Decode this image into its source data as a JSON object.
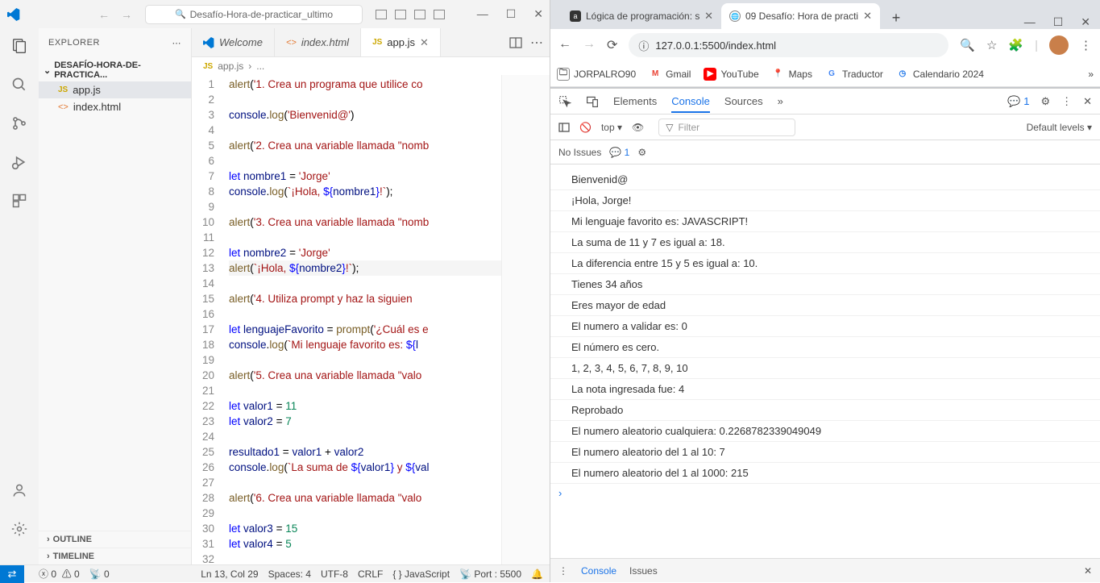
{
  "vscode": {
    "search_placeholder": "Desafío-Hora-de-practicar_ultimo",
    "explorer": {
      "title": "EXPLORER",
      "root": "DESAFÍO-HORA-DE-PRACTICA...",
      "files": [
        {
          "name": "app.js",
          "icon": "JS",
          "icon_color": "#cca700"
        },
        {
          "name": "index.html",
          "icon": "<>",
          "icon_color": "#e37933"
        }
      ],
      "outline": "OUTLINE",
      "timeline": "TIMELINE"
    },
    "tabs": {
      "welcome": "Welcome",
      "index": "index.html",
      "appjs": "app.js"
    },
    "breadcrumb": {
      "file": "app.js",
      "sep": "›",
      "rest": "..."
    },
    "code_lines": [
      {
        "n": 1,
        "html": "<span class='tok-fn'>alert</span>(<span class='tok-str'>'1. Crea un programa que utilice co</span>"
      },
      {
        "n": 2,
        "html": ""
      },
      {
        "n": 3,
        "html": "<span class='tok-id'>console</span>.<span class='tok-fn'>log</span>(<span class='tok-str'>'Bienvenid@'</span>)"
      },
      {
        "n": 4,
        "html": ""
      },
      {
        "n": 5,
        "html": "<span class='tok-fn'>alert</span>(<span class='tok-str'>'2. Crea una variable llamada \"nomb</span>"
      },
      {
        "n": 6,
        "html": ""
      },
      {
        "n": 7,
        "html": "<span class='tok-kw'>let</span> <span class='tok-id'>nombre1</span> = <span class='tok-str'>'Jorge'</span>"
      },
      {
        "n": 8,
        "html": "<span class='tok-id'>console</span>.<span class='tok-fn'>log</span>(<span class='tok-str'>`¡Hola, </span><span class='tok-kw'>${</span><span class='tok-id'>nombre1</span><span class='tok-kw'>}</span><span class='tok-str'>!`</span>);"
      },
      {
        "n": 9,
        "html": ""
      },
      {
        "n": 10,
        "html": "<span class='tok-fn'>alert</span>(<span class='tok-str'>'3. Crea una variable llamada \"nomb</span>"
      },
      {
        "n": 11,
        "html": ""
      },
      {
        "n": 12,
        "html": "<span class='tok-kw'>let</span> <span class='tok-id'>nombre2</span> = <span class='tok-str'>'Jorge'</span>"
      },
      {
        "n": 13,
        "html": "<span class='tok-fn'>alert</span>(<span class='tok-str'>`¡Hola, </span><span class='tok-kw'>${</span><span class='tok-id'>nombre2</span><span class='tok-kw'>}</span><span class='tok-str'>!`</span>);",
        "hl": true
      },
      {
        "n": 14,
        "html": ""
      },
      {
        "n": 15,
        "html": "<span class='tok-fn'>alert</span>(<span class='tok-str'>'4. Utiliza prompt y haz la siguien</span>"
      },
      {
        "n": 16,
        "html": ""
      },
      {
        "n": 17,
        "html": "<span class='tok-kw'>let</span> <span class='tok-id'>lenguajeFavorito</span> = <span class='tok-fn'>prompt</span>(<span class='tok-str'>'¿Cuál es e</span>"
      },
      {
        "n": 18,
        "html": "<span class='tok-id'>console</span>.<span class='tok-fn'>log</span>(<span class='tok-str'>`Mi lenguaje favorito es: </span><span class='tok-kw'>${</span><span class='tok-id'>l</span>"
      },
      {
        "n": 19,
        "html": ""
      },
      {
        "n": 20,
        "html": "<span class='tok-fn'>alert</span>(<span class='tok-str'>'5. Crea una variable llamada \"valo</span>"
      },
      {
        "n": 21,
        "html": ""
      },
      {
        "n": 22,
        "html": "<span class='tok-kw'>let</span> <span class='tok-id'>valor1</span> = <span class='tok-num'>11</span>"
      },
      {
        "n": 23,
        "html": "<span class='tok-kw'>let</span> <span class='tok-id'>valor2</span> = <span class='tok-num'>7</span>"
      },
      {
        "n": 24,
        "html": ""
      },
      {
        "n": 25,
        "html": "<span class='tok-id'>resultado1</span> = <span class='tok-id'>valor1</span> + <span class='tok-id'>valor2</span>"
      },
      {
        "n": 26,
        "html": "<span class='tok-id'>console</span>.<span class='tok-fn'>log</span>(<span class='tok-str'>`La suma de </span><span class='tok-kw'>${</span><span class='tok-id'>valor1</span><span class='tok-kw'>}</span><span class='tok-str'> y </span><span class='tok-kw'>${</span><span class='tok-id'>val</span>"
      },
      {
        "n": 27,
        "html": ""
      },
      {
        "n": 28,
        "html": "<span class='tok-fn'>alert</span>(<span class='tok-str'>'6. Crea una variable llamada \"valo</span>"
      },
      {
        "n": 29,
        "html": ""
      },
      {
        "n": 30,
        "html": "<span class='tok-kw'>let</span> <span class='tok-id'>valor3</span> = <span class='tok-num'>15</span>"
      },
      {
        "n": 31,
        "html": "<span class='tok-kw'>let</span> <span class='tok-id'>valor4</span> = <span class='tok-num'>5</span>"
      },
      {
        "n": 32,
        "html": ""
      }
    ],
    "status": {
      "errors": "0",
      "warnings": "0",
      "radio": "0",
      "cursor": "Ln 13, Col 29",
      "spaces": "Spaces: 4",
      "encoding": "UTF-8",
      "eol": "CRLF",
      "lang": "{ } JavaScript",
      "port": "Port : 5500"
    }
  },
  "browser": {
    "tabs": [
      {
        "title": "Lógica de programación: s",
        "icon_bg": "#333"
      },
      {
        "title": "09 Desafío: Hora de practi",
        "icon_bg": "#777"
      }
    ],
    "url": "127.0.0.1:5500/index.html",
    "bookmarks": [
      {
        "label": "JORPALRO90",
        "color": "#888"
      },
      {
        "label": "Gmail",
        "color": "#ea4335",
        "letter": "M"
      },
      {
        "label": "YouTube",
        "color": "#ff0000",
        "letter": "▶"
      },
      {
        "label": "Maps",
        "color": "#34a853",
        "letter": "📍"
      },
      {
        "label": "Traductor",
        "color": "#4285f4",
        "letter": "G"
      },
      {
        "label": "Calendario 2024",
        "color": "#1a73e8",
        "letter": "◷"
      }
    ],
    "devtools": {
      "tabs": {
        "elements": "Elements",
        "console": "Console",
        "sources": "Sources"
      },
      "issue_count": "1",
      "context": "top",
      "filter_placeholder": "Filter",
      "levels": "Default levels",
      "no_issues": "No Issues",
      "issues_count": "1",
      "logs": [
        "Bienvenid@",
        "¡Hola, Jorge!",
        "Mi lenguaje favorito es: JAVASCRIPT!",
        "La suma de 11 y 7 es igual a: 18.",
        "La diferencia entre 15 y 5 es igual a: 10.",
        "Tienes 34 años",
        "Eres mayor de edad",
        "El numero a validar es: 0",
        "El número es cero.",
        "1, 2, 3, 4, 5, 6, 7, 8, 9, 10",
        "La nota ingresada fue: 4",
        "Reprobado",
        "El numero aleatorio cualquiera: 0.2268782339049049",
        "El numero aleatorio del 1 al 10: 7",
        "El numero aleatorio del 1 al 1000: 215"
      ],
      "drawer": {
        "console": "Console",
        "issues": "Issues"
      }
    }
  }
}
